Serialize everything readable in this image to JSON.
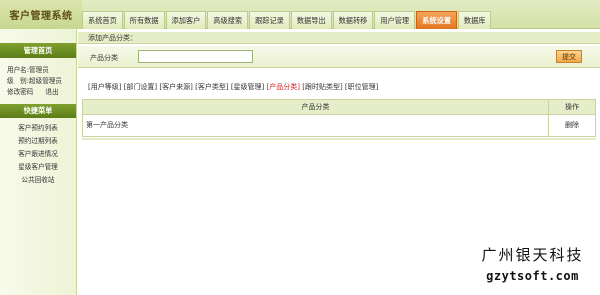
{
  "header": {
    "brand": "客户管理系统",
    "tabs": [
      {
        "label": "系统首页",
        "active": false
      },
      {
        "label": "所有数据",
        "active": false
      },
      {
        "label": "添加客户",
        "active": false
      },
      {
        "label": "高级搜索",
        "active": false
      },
      {
        "label": "跟踪记录",
        "active": false
      },
      {
        "label": "数据导出",
        "active": false
      },
      {
        "label": "数据转移",
        "active": false
      },
      {
        "label": "用户管理",
        "active": false
      },
      {
        "label": "系统设置",
        "active": true
      },
      {
        "label": "数据库",
        "active": false
      }
    ]
  },
  "sidebar": {
    "home_title": "管理首页",
    "user_name_line": "用户名:管理员",
    "user_level_line": "级　别:超级管理员",
    "change_password": "修改密码",
    "logout": "退出",
    "quick_title": "快捷菜单",
    "quick_items": [
      "客户预约列表",
      "预约过期列表",
      "客户跟进情况",
      "星级客户管理",
      "公共回收站"
    ]
  },
  "main": {
    "sub_title": "添加产品分类：",
    "form": {
      "label": "产品分类",
      "input_value": "",
      "submit_label": "提交"
    },
    "links": [
      {
        "label": "[用户等级]",
        "active": false
      },
      {
        "label": "[部门设置]",
        "active": false
      },
      {
        "label": "[客户来源]",
        "active": false
      },
      {
        "label": "[客户类型]",
        "active": false
      },
      {
        "label": "[星级管理]",
        "active": false
      },
      {
        "label": "[产品分类]",
        "active": true
      },
      {
        "label": "[跟时贴类型]",
        "active": false
      },
      {
        "label": "[职位管理]",
        "active": false
      }
    ],
    "table": {
      "col_name": "产品分类",
      "col_op": "操作",
      "rows": [
        {
          "name": "第一产品分类",
          "op": "删除"
        }
      ]
    }
  },
  "watermark": {
    "cn": "广州银天科技",
    "en": "gzytsoft.com"
  },
  "colors": {
    "accent_active_tab": "#e1761f",
    "sidebar_header": "#6a8b22",
    "active_link": "#d42020",
    "header_bg": "#d4e1a6"
  }
}
